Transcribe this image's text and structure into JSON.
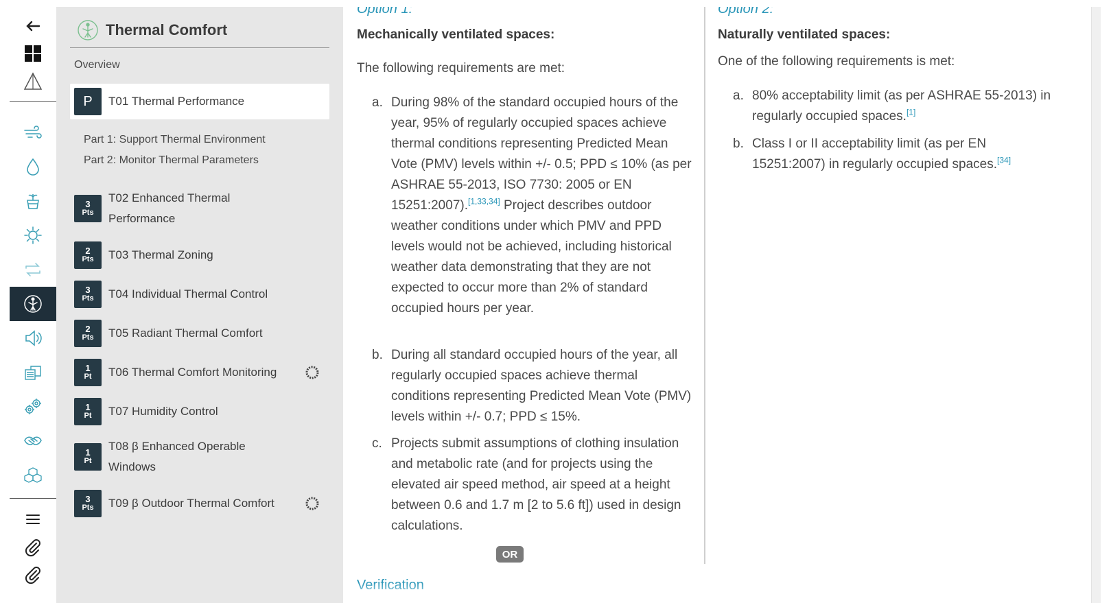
{
  "rail": {
    "items": [
      {
        "name": "back-arrow-icon"
      },
      {
        "name": "dashboard-grid-icon"
      },
      {
        "name": "triangle-icon"
      },
      {
        "name": "air-icon"
      },
      {
        "name": "water-icon"
      },
      {
        "name": "nourishment-icon"
      },
      {
        "name": "light-icon"
      },
      {
        "name": "movement-icon"
      },
      {
        "name": "thermal-comfort-icon"
      },
      {
        "name": "sound-icon"
      },
      {
        "name": "materials-icon"
      },
      {
        "name": "mind-icon"
      },
      {
        "name": "community-icon"
      },
      {
        "name": "innovation-icon"
      },
      {
        "name": "menu-icon"
      },
      {
        "name": "paperclip-icon"
      },
      {
        "name": "paperclip-icon-2"
      }
    ],
    "active_color": "#1f2f3a",
    "accent_color": "#3a9fb5"
  },
  "sidebar": {
    "title": "Thermal Comfort",
    "overview": "Overview",
    "features": [
      {
        "badge_num": "P",
        "badge_unit": "",
        "label": "T01 Thermal Performance",
        "selected": true
      },
      {
        "badge_num": "3",
        "badge_unit": "Pts",
        "label": "T02 Enhanced Thermal Performance"
      },
      {
        "badge_num": "2",
        "badge_unit": "Pts",
        "label": "T03 Thermal Zoning"
      },
      {
        "badge_num": "3",
        "badge_unit": "Pts",
        "label": "T04 Individual Thermal Control"
      },
      {
        "badge_num": "2",
        "badge_unit": "Pts",
        "label": "T05 Radiant Thermal Comfort"
      },
      {
        "badge_num": "1",
        "badge_unit": "Pt",
        "label": "T06 Thermal Comfort Monitoring",
        "extra_icon": "dotted-circle-icon"
      },
      {
        "badge_num": "1",
        "badge_unit": "Pt",
        "label": "T07 Humidity Control"
      },
      {
        "badge_num": "1",
        "badge_unit": "Pt",
        "label": "T08 β Enhanced Operable Windows"
      },
      {
        "badge_num": "3",
        "badge_unit": "Pts",
        "label": "T09 β Outdoor Thermal Comfort",
        "extra_icon": "dotted-circle-icon"
      }
    ],
    "subparts": [
      "Part 1: Support Thermal Environment",
      "Part 2: Monitor Thermal Parameters"
    ]
  },
  "content": {
    "option1": {
      "title": "Option 1:",
      "heading": "Mechanically ventilated spaces:",
      "intro": "The following requirements are met:",
      "items": [
        {
          "mark": "a.",
          "text": "During 98% of the standard occupied hours of the year, 95% of regularly occupied spaces achieve thermal conditions representing Predicted Mean Vote (PMV) levels within +/- 0.5; PPD ≤ 10% (as per ASHRAE 55-2013, ISO 7730: 2005 or EN 15251:2007).",
          "sup": "[1,33,34]",
          "text_after": " Project describes outdoor weather conditions under which PMV and PPD levels would not be achieved, including historical weather data demonstrating that they are not expected to occur more than 2% of standard occupied hours per year."
        },
        {
          "mark": "b.",
          "text": "During all standard occupied hours of the year, all regularly occupied spaces achieve thermal conditions representing Predicted Mean Vote (PMV) levels within +/- 0.7; PPD ≤ 15%."
        },
        {
          "mark": "c.",
          "text": "Projects submit assumptions of clothing insulation and metabolic rate (and for projects using the elevated air speed method, air speed at a height between 0.6 and 1.7 m [2 to 5.6 ft]) used in design calculations."
        }
      ],
      "or_label": "OR"
    },
    "option2": {
      "title": "Option 2:",
      "heading": "Naturally ventilated spaces:",
      "intro": "One of the following requirements is met:",
      "items": [
        {
          "mark": "a.",
          "text": "80% acceptability limit (as per ASHRAE 55-2013) in regularly occupied spaces.",
          "sup": "[1]"
        },
        {
          "mark": "b.",
          "text": "Class I or II acceptability limit (as per EN 15251:2007) in regularly occupied spaces.",
          "sup": "[34]"
        }
      ]
    },
    "verification_heading": "Verification",
    "link_color": "#2a96b8"
  }
}
